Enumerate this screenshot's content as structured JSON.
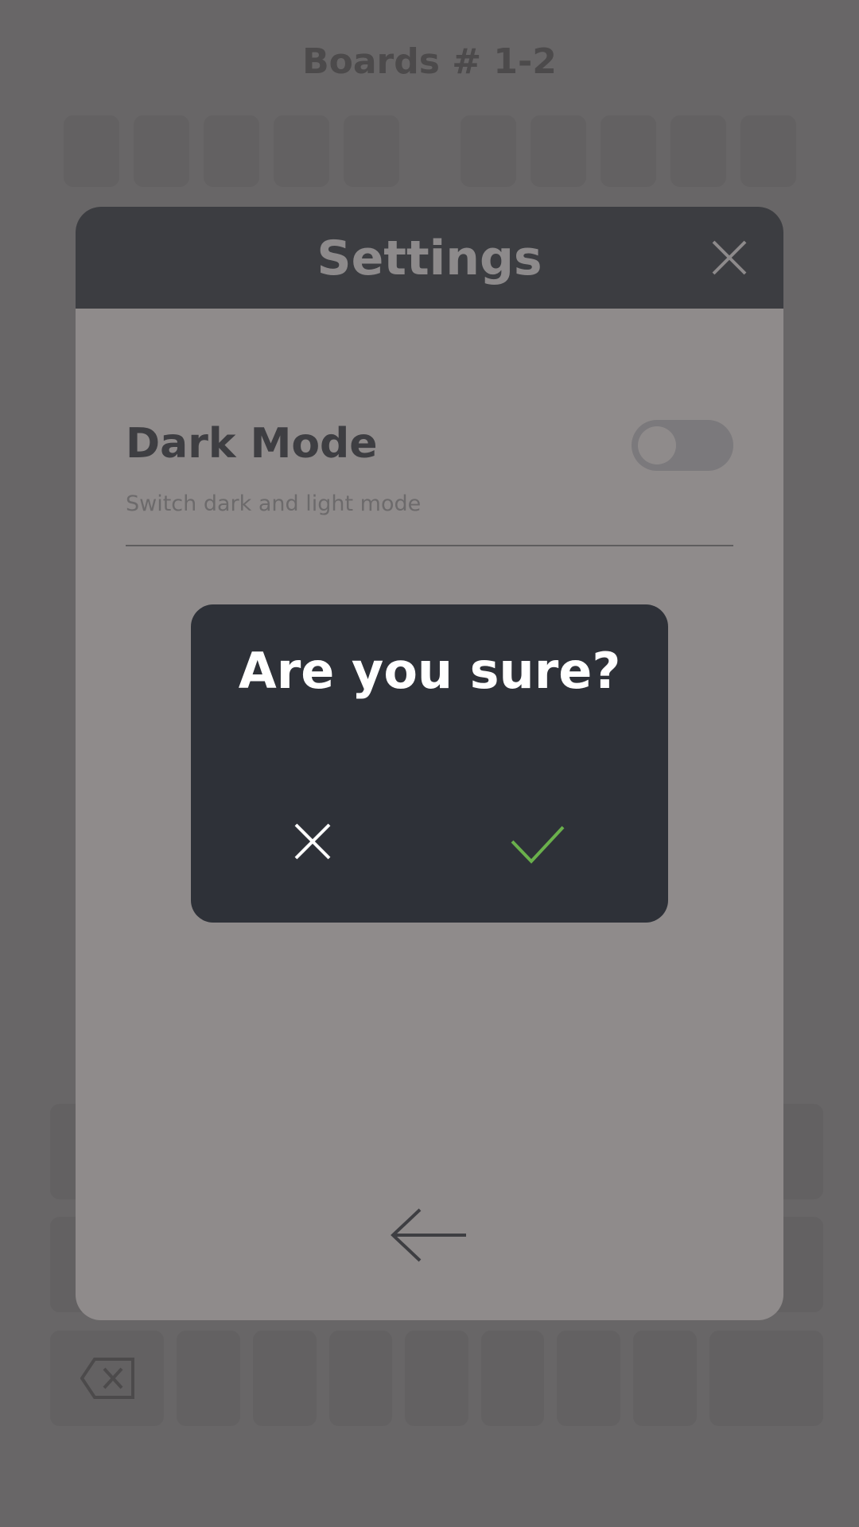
{
  "game": {
    "title": "Boards # 1-2"
  },
  "settings": {
    "title": "Settings",
    "dark_mode": {
      "label": "Dark Mode",
      "description": "Switch dark and light mode",
      "enabled": false
    }
  },
  "confirm": {
    "question": "Are you sure?"
  },
  "icons": {
    "close": "close-icon",
    "back": "arrow-left-icon",
    "cancel": "x-icon",
    "confirm": "check-icon",
    "backspace": "backspace-icon"
  },
  "colors": {
    "confirm_accent": "#6ab04c",
    "dialog_bg": "#2e3138",
    "header_bg": "#3c3d41",
    "modal_bg": "#8f8b8b"
  }
}
